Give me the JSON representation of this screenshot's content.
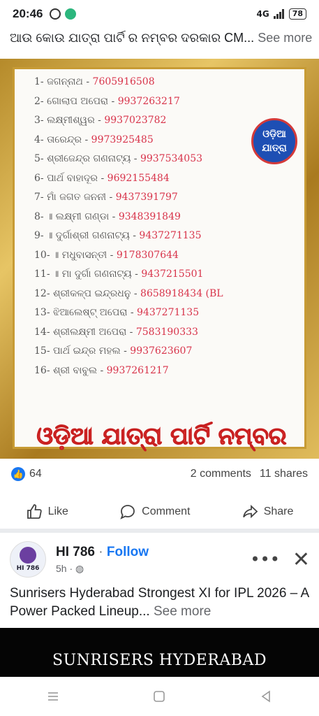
{
  "status": {
    "time": "20:46",
    "network": "4G",
    "battery": "78"
  },
  "post1": {
    "caption": "ଆଉ କୋଉ ଯାତ୍ରା ପାର୍ଟି ର ନମ୍ବର ଦରକାର CM...",
    "see_more": "See more",
    "image": {
      "rows": [
        {
          "name": "1- ଜଗନ୍ନାଥ -",
          "phone": "7605916508"
        },
        {
          "name": "2- ଗୋଲାପ ଅପେରା -",
          "phone": "9937263217"
        },
        {
          "name": "3- ଲକ୍ଷ୍ମୀଶ୍ୱର -",
          "phone": "9937023782"
        },
        {
          "name": "4- ତାରେନ୍ଦ୍ର -",
          "phone": "9973925485"
        },
        {
          "name": "5- ଶ୍ରୀଜେନ୍ଦ୍ର ଗଣନାଟ୍ୟ -",
          "phone": "9937534053"
        },
        {
          "name": "6- ପାର୍ଥ ବାହାଦୂର -",
          "phone": "9692155484"
        },
        {
          "name": "7- ମାଁ ଜଗତ ଜନନୀ -",
          "phone": "9437391797"
        },
        {
          "name": "8- ॥ ଲକ୍ଷ୍ମୀ ଗଣ୍ଡା -",
          "phone": "9348391849"
        },
        {
          "name": "9- ॥ ଦୁର୍ଗାଶ୍ରୀ ଗଣନାଟ୍ୟ -",
          "phone": "9437271135"
        },
        {
          "name": "10- ॥ ମଧୁବାସନ୍ତୀ -",
          "phone": "9178307644"
        },
        {
          "name": "11- ॥ ମା ଦୁର୍ଗା ଗଣନାଟ୍ୟ -",
          "phone": "9437215501"
        },
        {
          "name": "12- ଶ୍ରୀକଳ୍ପ ଇନ୍ଦ୍ରଧନୁ -",
          "phone": "8658918434 (BL"
        },
        {
          "name": "13- ଝିଆଲେଷ୍ଟ୍ ଅପେରା -",
          "phone": "9437271135"
        },
        {
          "name": "14- ଶ୍ରୀଲକ୍ଷ୍ମୀ ଅପେରା -",
          "phone": "7583190333"
        },
        {
          "name": "15- ପାର୍ଥ ଇନ୍ଦ୍ର ମହଲ -",
          "phone": "9937623607"
        },
        {
          "name": "16- ଶ୍ରୀ ବାବୁଲ -",
          "phone": "9937261217"
        }
      ],
      "badge": "ଓଡ଼ିଆ ଯାତ୍ରା",
      "banner": "ଓଡ଼ିଆ ଯାତ୍ରା ପାର୍ଟି ନମ୍ବର"
    },
    "likes": "64",
    "comments": "2 comments",
    "shares": "11 shares",
    "actions": {
      "like": "Like",
      "comment": "Comment",
      "share": "Share"
    }
  },
  "post2": {
    "page_name": "HI 786",
    "follow": "Follow",
    "time": "5h",
    "avatar_label": "HI 786",
    "caption": "Sunrisers Hyderabad Strongest XI for IPL 2026 – A Power Packed Lineup...",
    "see_more": "See more",
    "image_text": "SUNRISERS HYDERABAD"
  }
}
